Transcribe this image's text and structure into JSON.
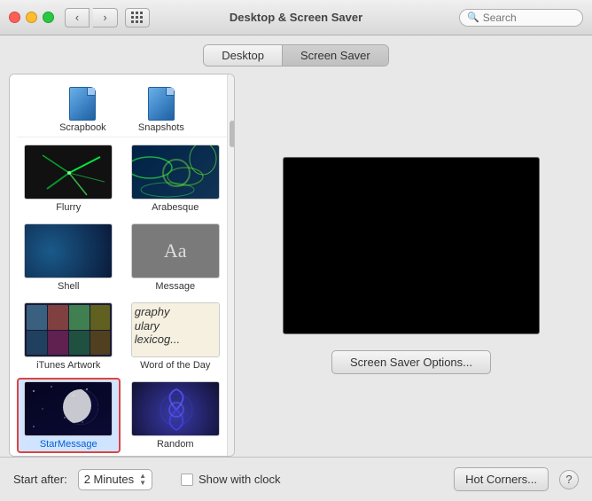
{
  "titleBar": {
    "title": "Desktop & Screen Saver",
    "searchPlaceholder": "Search"
  },
  "segmentControl": {
    "buttons": [
      {
        "id": "desktop",
        "label": "Desktop"
      },
      {
        "id": "screenSaver",
        "label": "Screen Saver",
        "active": true
      }
    ]
  },
  "topIcons": [
    {
      "label": "Scrapbook"
    },
    {
      "label": "Snapshots"
    }
  ],
  "savers": [
    {
      "id": "flurry",
      "label": "Flurry",
      "selected": false
    },
    {
      "id": "arabesque",
      "label": "Arabesque",
      "selected": false
    },
    {
      "id": "shell",
      "label": "Shell",
      "selected": false
    },
    {
      "id": "message",
      "label": "Message",
      "selected": false
    },
    {
      "id": "itunesArtwork",
      "label": "iTunes Artwork",
      "selected": false
    },
    {
      "id": "wordOfDay",
      "label": "Word of the Day",
      "selected": false
    },
    {
      "id": "starMessage",
      "label": "StarMessage",
      "selected": true
    },
    {
      "id": "random",
      "label": "Random",
      "selected": false
    }
  ],
  "rightPanel": {
    "optionsButtonLabel": "Screen Saver Options..."
  },
  "bottomBar": {
    "startAfterLabel": "Start after:",
    "startAfterValue": "2 Minutes",
    "showWithClockLabel": "Show with clock",
    "hotCornersLabel": "Hot Corners...",
    "helpLabel": "?"
  }
}
